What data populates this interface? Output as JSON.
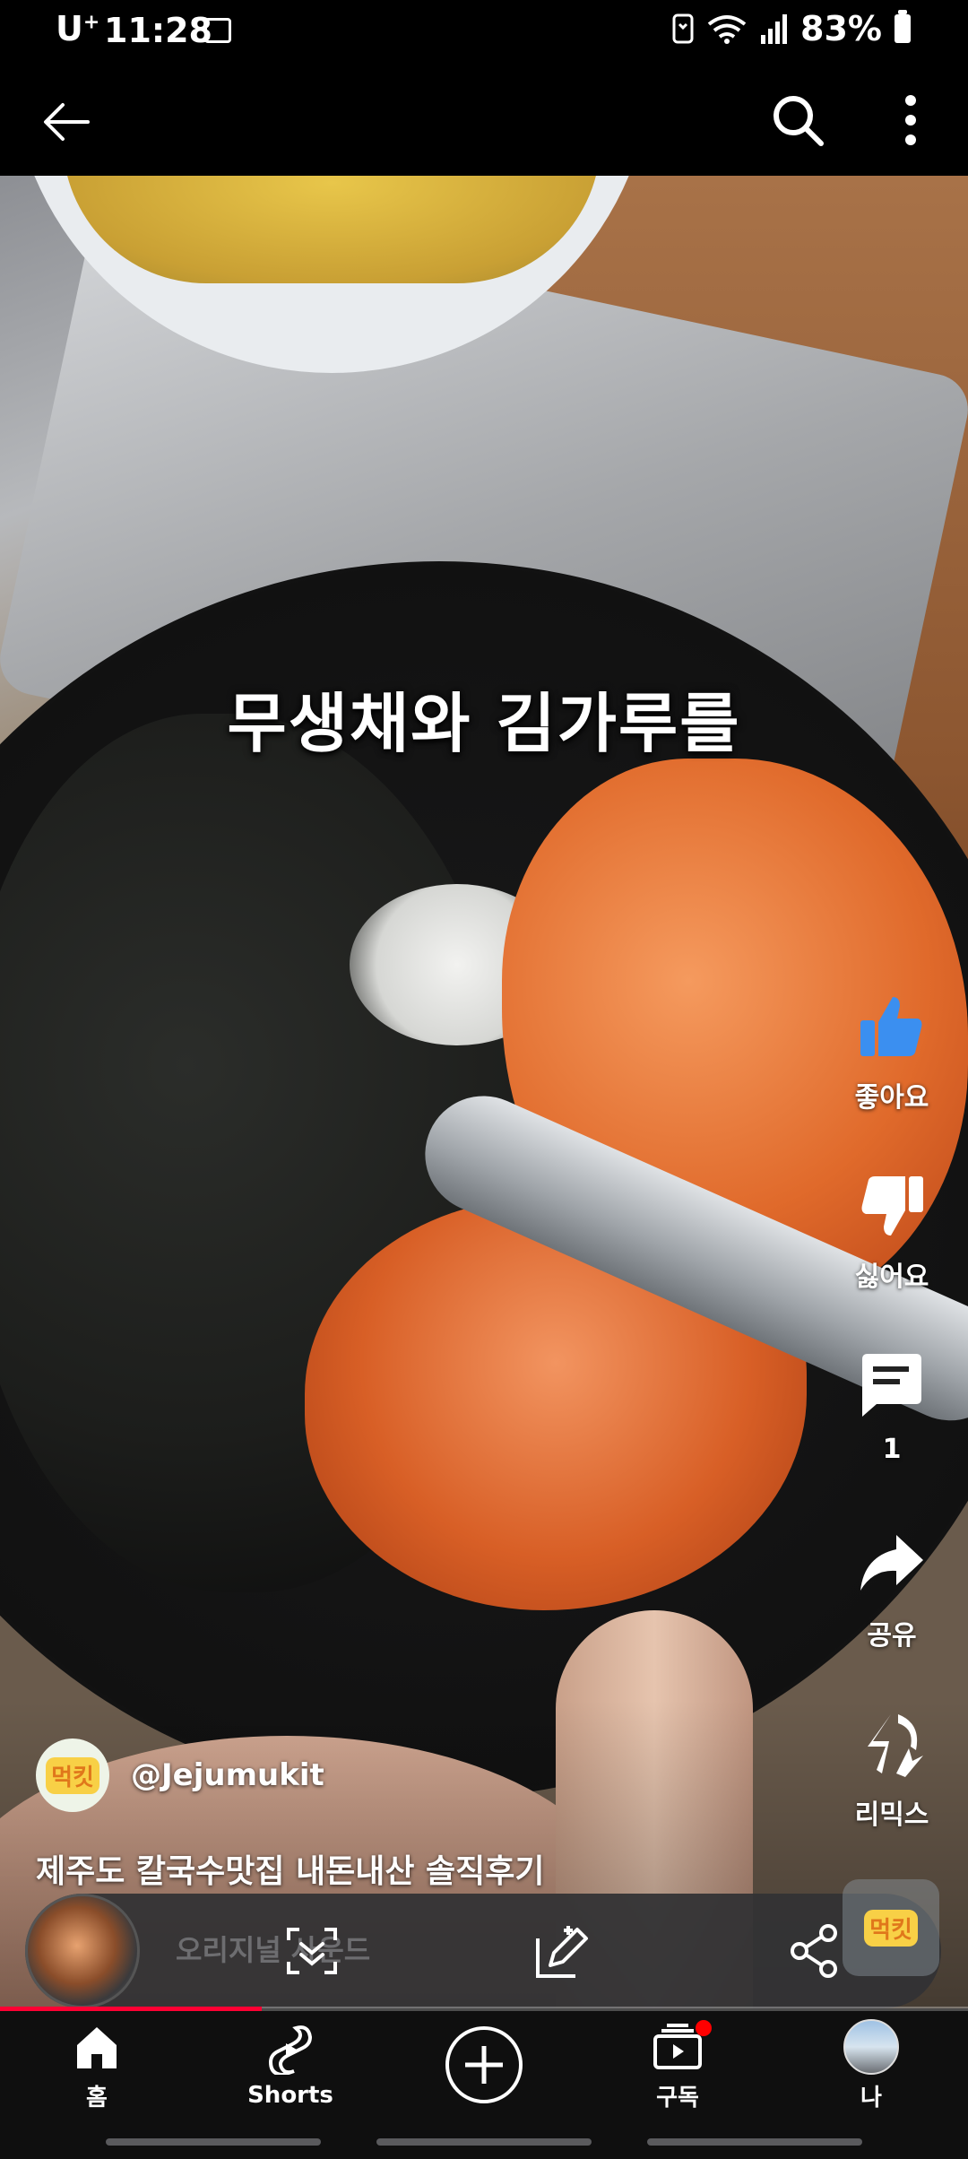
{
  "status_bar": {
    "carrier": "U",
    "carrier_sup": "+",
    "time": "11:28",
    "battery": "83%"
  },
  "video": {
    "caption": "무생채와 김가루를",
    "channel_handle": "@Jejumukit",
    "channel_logo_text": "먹킷",
    "title": "제주도 칼국수맛집 내돈내산 솔직후기",
    "progress_fraction": 0.27
  },
  "actions": {
    "like_label": "좋아요",
    "dislike_label": "싫어요",
    "comments_count": "1",
    "share_label": "공유",
    "remix_label": "리믹스"
  },
  "mini_player": {
    "text": "오리지널 사운드"
  },
  "bottom_nav": {
    "home": "홈",
    "shorts": "Shorts",
    "subscriptions": "구독",
    "you": "나"
  },
  "colors": {
    "accent_red": "#ff0033",
    "like_blue": "#3b8ff0"
  }
}
